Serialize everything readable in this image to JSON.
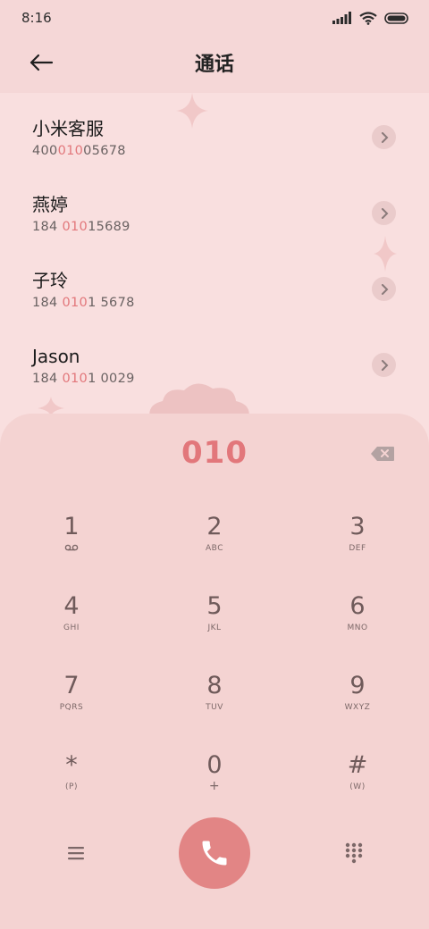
{
  "status_bar": {
    "time": "8:16"
  },
  "header": {
    "title": "通话"
  },
  "contacts": [
    {
      "name": "小米客服",
      "number_pre": "400",
      "number_match": "010",
      "number_post": "05678"
    },
    {
      "name": "燕婷",
      "number_pre": "184 ",
      "number_match": "010",
      "number_post": "15689"
    },
    {
      "name": "子玲",
      "number_pre": "184 ",
      "number_match": "010",
      "number_post": "1 5678"
    },
    {
      "name": "Jason",
      "number_pre": "184 ",
      "number_match": "010",
      "number_post": "1 0029"
    }
  ],
  "dialpad": {
    "input": "010",
    "keys": [
      {
        "digit": "1",
        "letters": ""
      },
      {
        "digit": "2",
        "letters": "ABC"
      },
      {
        "digit": "3",
        "letters": "DEF"
      },
      {
        "digit": "4",
        "letters": "GHI"
      },
      {
        "digit": "5",
        "letters": "JKL"
      },
      {
        "digit": "6",
        "letters": "MNO"
      },
      {
        "digit": "7",
        "letters": "PQRS"
      },
      {
        "digit": "8",
        "letters": "TUV"
      },
      {
        "digit": "9",
        "letters": "WXYZ"
      },
      {
        "digit": "*",
        "letters": "(P)"
      },
      {
        "digit": "0",
        "letters": "+"
      },
      {
        "digit": "#",
        "letters": "(W)"
      }
    ]
  },
  "colors": {
    "accent": "#e2777b",
    "call_button": "#e28585",
    "background": "#f9dfdf",
    "dialpad_bg": "#f4d3d2"
  },
  "icons": {
    "back": "arrow-left-icon",
    "chevron": "chevron-right-icon",
    "backspace": "backspace-icon",
    "voicemail": "voicemail-icon",
    "menu": "menu-icon",
    "call": "phone-icon",
    "keypad": "keypad-icon"
  }
}
